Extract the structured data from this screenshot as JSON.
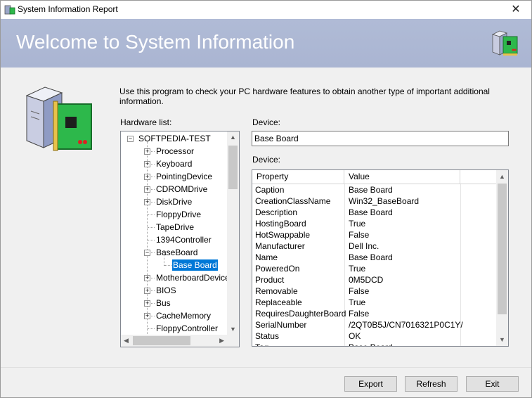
{
  "window": {
    "title": "System Information Report",
    "close_symbol": "✕"
  },
  "banner": {
    "title": "Welcome to System Information"
  },
  "intro": "Use this program to check your PC hardware features to obtain another type of important additional information.",
  "labels": {
    "hardware_list": "Hardware list:",
    "device_1": "Device:",
    "device_2": "Device:"
  },
  "tree": {
    "root": "SOFTPEDIA-TEST",
    "items": [
      {
        "label": "Processor",
        "expandable": true
      },
      {
        "label": "Keyboard",
        "expandable": true
      },
      {
        "label": "PointingDevice",
        "expandable": true
      },
      {
        "label": "CDROMDrive",
        "expandable": true
      },
      {
        "label": "DiskDrive",
        "expandable": true
      },
      {
        "label": "FloppyDrive",
        "expandable": false
      },
      {
        "label": "TapeDrive",
        "expandable": false
      },
      {
        "label": "1394Controller",
        "expandable": false
      },
      {
        "label": "BaseBoard",
        "expandable": true,
        "expanded": true
      },
      {
        "label": "Base Board",
        "child": true,
        "selected": true
      },
      {
        "label": "MotherboardDevice",
        "expandable": true
      },
      {
        "label": "BIOS",
        "expandable": true
      },
      {
        "label": "Bus",
        "expandable": true
      },
      {
        "label": "CacheMemory",
        "expandable": true
      },
      {
        "label": "FloppyController",
        "expandable": false
      }
    ]
  },
  "device_value": "Base Board",
  "grid": {
    "headers": [
      "Property",
      "Value"
    ],
    "rows": [
      [
        "Caption",
        "Base Board"
      ],
      [
        "CreationClassName",
        "Win32_BaseBoard"
      ],
      [
        "Description",
        "Base Board"
      ],
      [
        "HostingBoard",
        "True"
      ],
      [
        "HotSwappable",
        "False"
      ],
      [
        "Manufacturer",
        "Dell Inc."
      ],
      [
        "Name",
        "Base Board"
      ],
      [
        "PoweredOn",
        "True"
      ],
      [
        "Product",
        "0M5DCD"
      ],
      [
        "Removable",
        "False"
      ],
      [
        "Replaceable",
        "True"
      ],
      [
        "RequiresDaughterBoard",
        "False"
      ],
      [
        "SerialNumber",
        "/2QT0B5J/CN7016321P0C1Y/"
      ],
      [
        "Status",
        "OK"
      ],
      [
        "Tag",
        "Base Board"
      ]
    ]
  },
  "buttons": {
    "export": "Export",
    "refresh": "Refresh",
    "exit": "Exit"
  },
  "colors": {
    "banner": "#aab5d2",
    "selection": "#0078d7",
    "green_card": "#2db84b"
  }
}
